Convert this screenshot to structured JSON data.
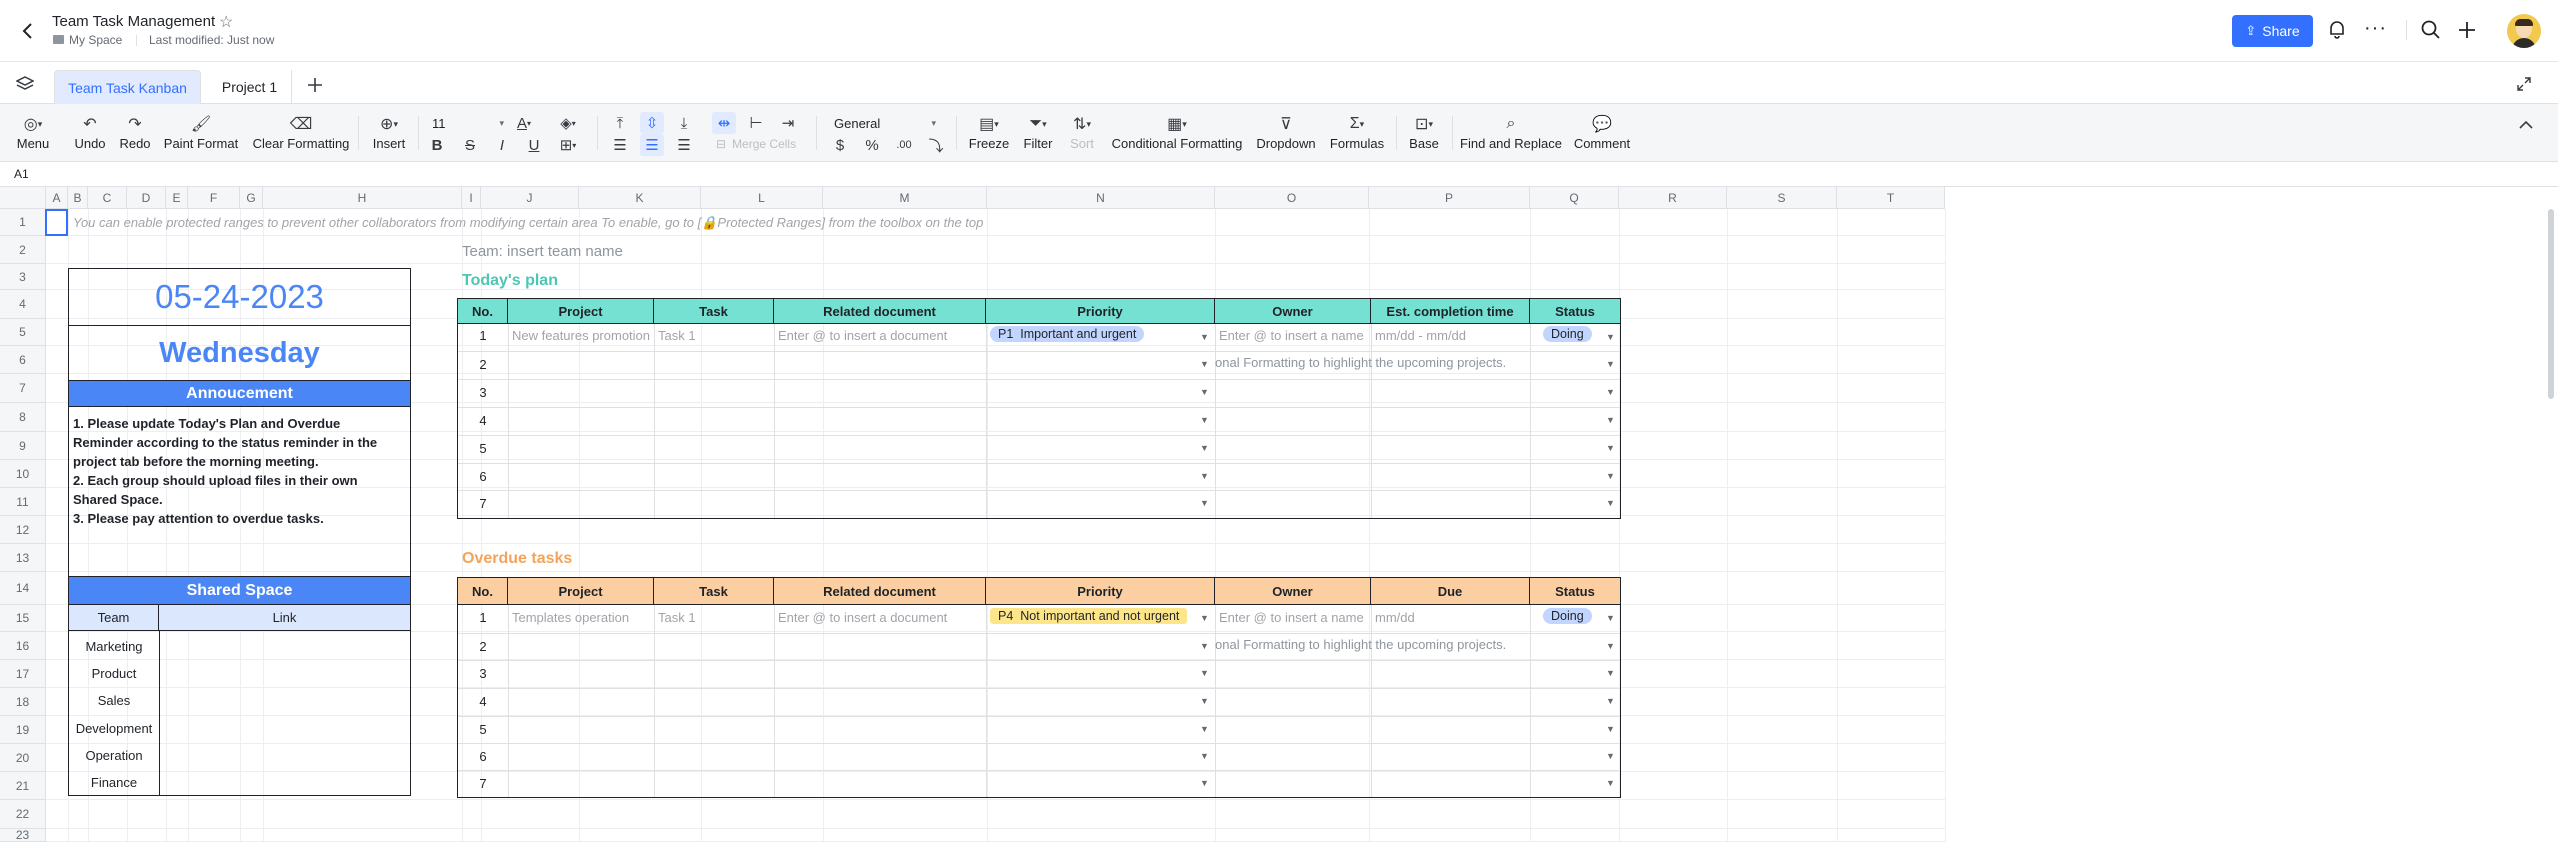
{
  "header": {
    "title": "Team Task Management",
    "location": "My Space",
    "last_modified": "Last modified: Just now",
    "share_label": "Share"
  },
  "tabs": [
    {
      "label": "Team Task Kanban",
      "active": true
    },
    {
      "label": "Project 1",
      "active": false
    }
  ],
  "toolbar": {
    "menu": "Menu",
    "undo": "Undo",
    "redo": "Redo",
    "paint_format": "Paint Format",
    "clear_formatting": "Clear Formatting",
    "insert": "Insert",
    "font_size": "11",
    "merge_cells": "Merge Cells",
    "number_format": "General",
    "freeze": "Freeze",
    "filter": "Filter",
    "sort": "Sort",
    "conditional_formatting": "Conditional Formatting",
    "dropdown": "Dropdown",
    "formulas": "Formulas",
    "base": "Base",
    "find_replace": "Find and Replace",
    "comment": "Comment"
  },
  "cell_ref": "A1",
  "columns": [
    "A",
    "B",
    "C",
    "D",
    "E",
    "F",
    "G",
    "H",
    "I",
    "J",
    "K",
    "L",
    "M",
    "N",
    "O",
    "P",
    "Q",
    "R",
    "S",
    "T"
  ],
  "rows": [
    "1",
    "2",
    "3",
    "4",
    "5",
    "6",
    "7",
    "8",
    "9",
    "10",
    "11",
    "12",
    "13",
    "14",
    "15",
    "16",
    "17",
    "18",
    "19",
    "20",
    "21",
    "22",
    "23"
  ],
  "notice": "You can enable protected ranges to prevent other collaborators from modifying certain area To enable, go to [🔒Protected Ranges] from the toolbox on the top",
  "team_label": "Team: insert team name",
  "left_panel": {
    "date": "05-24-2023",
    "weekday": "Wednesday",
    "announcement_title": "Annoucement",
    "announcement_lines": [
      "1. Please update Today's Plan and Overdue",
      "Reminder according to the status reminder in the",
      "project tab before the morning meeting.",
      "2. Each group should upload files in their own",
      "Shared Space.",
      "3. Please pay attention to overdue tasks."
    ],
    "shared_space_title": "Shared Space",
    "shared_headers": [
      "Team",
      "Link"
    ],
    "teams": [
      "Marketing",
      "Product",
      "Sales",
      "Development",
      "Operation",
      "Finance"
    ]
  },
  "todays_plan": {
    "title": "Today's plan",
    "headers": [
      "No.",
      "Project",
      "Task",
      "Related document",
      "Priority",
      "Owner",
      "Est. completion time",
      "Status"
    ],
    "row1": {
      "no": "1",
      "project": "New features promotion",
      "task": "Task 1",
      "doc": "Enter @ to insert a document",
      "priority_code": "P1",
      "priority": "Important and urgent",
      "owner": "Enter @ to insert a name",
      "time": "mm/dd - mm/dd",
      "status": "Doing"
    },
    "overflow_text": "onal Formatting to highlight the upcoming projects.",
    "numbers": [
      "2",
      "3",
      "4",
      "5",
      "6",
      "7"
    ]
  },
  "overdue": {
    "title": "Overdue tasks",
    "headers": [
      "No.",
      "Project",
      "Task",
      "Related document",
      "Priority",
      "Owner",
      "Due",
      "Status"
    ],
    "row1": {
      "no": "1",
      "project": "Templates operation",
      "task": "Task 1",
      "doc": "Enter @ to insert a document",
      "priority_code": "P4",
      "priority": "Not important and not urgent",
      "owner": "Enter @ to insert a name",
      "due": "mm/dd",
      "status": "Doing"
    },
    "overflow_text": "onal Formatting to highlight the upcoming projects.",
    "numbers": [
      "2",
      "3",
      "4",
      "5",
      "6",
      "7"
    ]
  },
  "colors": {
    "accent": "#3370ff",
    "teal_header": "#75e1d2",
    "teal_title": "#4ec6b4",
    "orange_header": "#fbcfa2",
    "orange_title": "#f5a35b",
    "blue_bar": "#4a86f5",
    "pill_blue": "#c2d5ff",
    "pill_yellow": "#fde68a"
  }
}
